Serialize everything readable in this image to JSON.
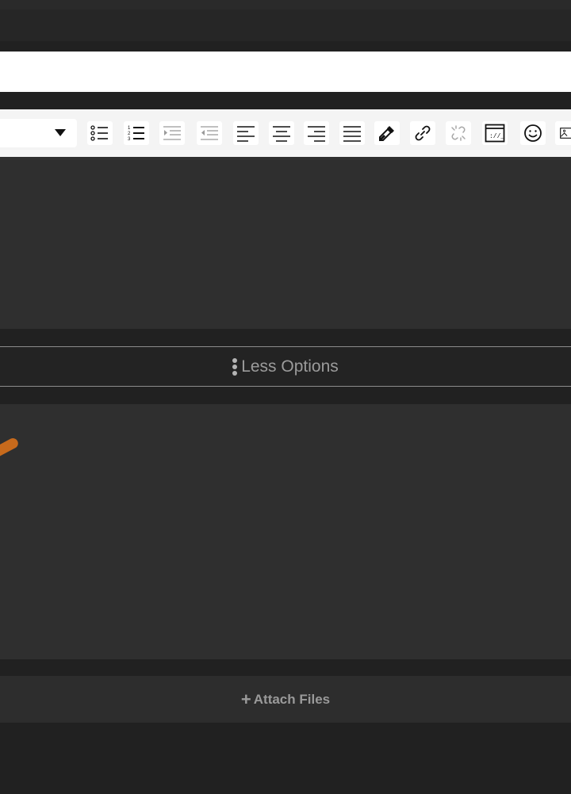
{
  "options_toggle": {
    "label": "Less Options",
    "icon": "vertical-dots-icon"
  },
  "attach": {
    "label": "Attach Files",
    "icon": "plus-icon"
  },
  "toolbar": {
    "buttons": [
      "bulleted-list-icon",
      "numbered-list-icon",
      "indent-icon",
      "outdent-icon",
      "align-left-icon",
      "align-center-icon",
      "align-right-icon",
      "align-justify-icon",
      "color-picker-icon",
      "link-icon",
      "unlink-icon",
      "code-block-icon",
      "emoji-icon",
      "image-icon"
    ]
  },
  "colors": {
    "background": "#212121",
    "panel": "#2f2f2f",
    "toolbar": "#f4f4f4",
    "accent": "#c76a1c",
    "muted_text": "#9b9b9b"
  }
}
